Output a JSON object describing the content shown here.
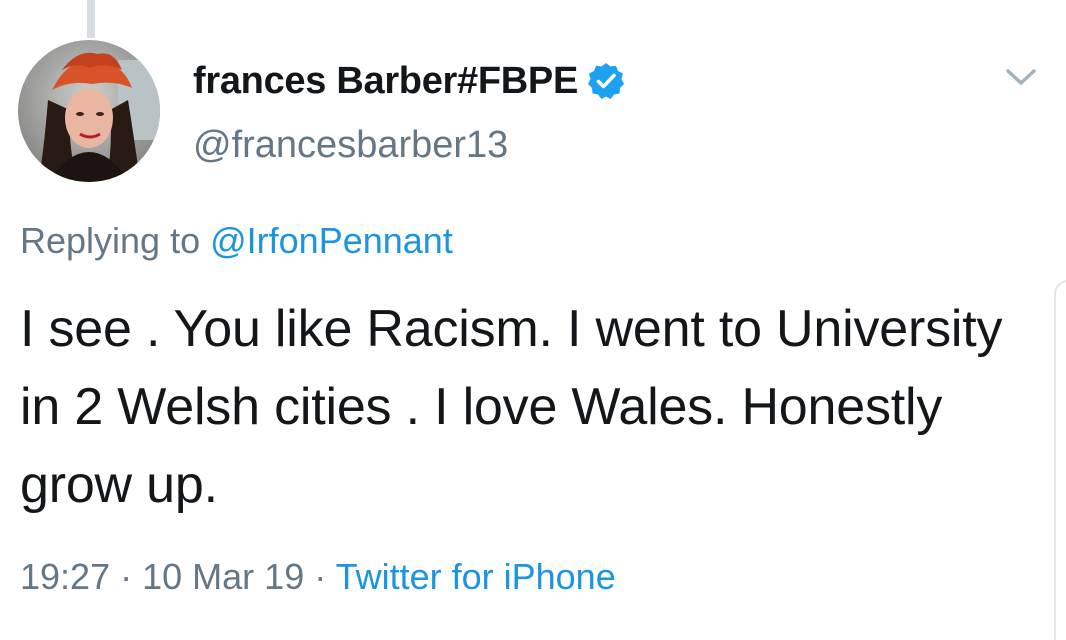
{
  "tweet": {
    "display_name": "frances Barber#FBPE",
    "handle": "@francesbarber13",
    "verified_icon": "verified-badge-icon",
    "menu_icon": "chevron-down-icon",
    "replying_prefix": "Replying to",
    "replying_to": "@IrfonPennant",
    "text": "I see . You like Racism. I went to University in 2 Welsh cities . I love Wales. Honestly grow up.",
    "time": "19:27",
    "date": "10 Mar 19",
    "separator": "·",
    "source": "Twitter for iPhone"
  },
  "colors": {
    "link": "#1b95e0",
    "secondary_text": "#657786",
    "primary_text": "#14171a"
  }
}
